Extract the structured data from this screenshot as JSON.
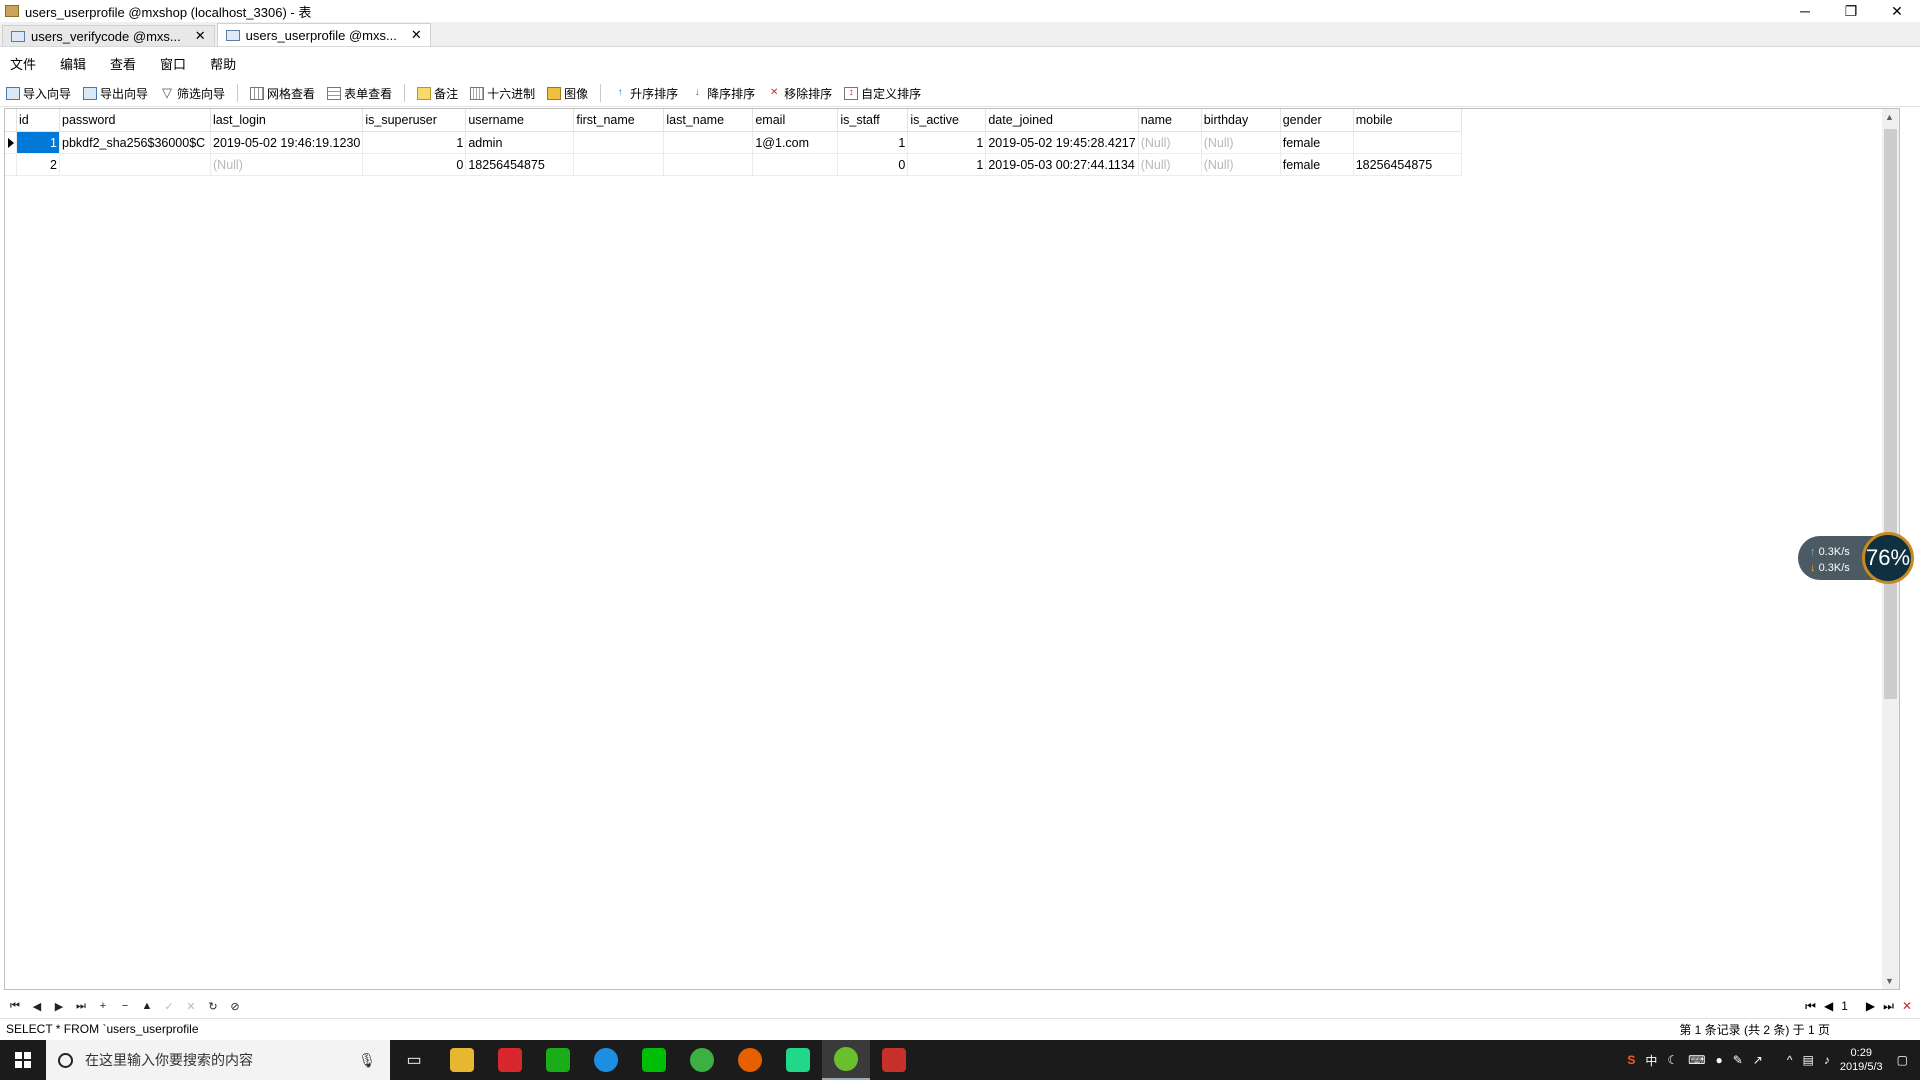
{
  "window": {
    "title": "users_userprofile @mxshop (localhost_3306) - 表",
    "minimize": "─",
    "restore": "❐",
    "close": "✕"
  },
  "tabs": [
    {
      "label": "users_verifycode @mxs...",
      "close": "✕"
    },
    {
      "label": "users_userprofile @mxs...",
      "close": "✕"
    }
  ],
  "menu": [
    "文件",
    "编辑",
    "查看",
    "窗口",
    "帮助"
  ],
  "toolbar": {
    "import": "导入向导",
    "export": "导出向导",
    "filter": "筛选向导",
    "grid_view": "网格查看",
    "form_view": "表单查看",
    "memo": "备注",
    "hex": "十六进制",
    "image": "图像",
    "sort_asc": "升序排序",
    "sort_desc": "降序排序",
    "remove_sort": "移除排序",
    "custom_sort": "自定义排序"
  },
  "grid": {
    "columns": [
      "id",
      "password",
      "last_login",
      "is_superuser",
      "username",
      "first_name",
      "last_name",
      "email",
      "is_staff",
      "is_active",
      "date_joined",
      "name",
      "birthday",
      "gender",
      "mobile"
    ],
    "rows": [
      [
        "1",
        "pbkdf2_sha256$36000$C",
        "2019-05-02 19:46:19.1230",
        "1",
        "admin",
        "",
        "",
        "1@1.com",
        "1",
        "1",
        "2019-05-02 19:45:28.4217",
        "(Null)",
        "(Null)",
        "female",
        ""
      ],
      [
        "2",
        "",
        "(Null)",
        "0",
        "18256454875",
        "",
        "",
        "",
        "0",
        "1",
        "2019-05-03 00:27:44.1134",
        "(Null)",
        "(Null)",
        "female",
        "18256454875"
      ]
    ]
  },
  "net_widget": {
    "up": "0.3K/s",
    "down": "0.3K/s",
    "percent": "76%"
  },
  "nav": {
    "page": "1"
  },
  "status": {
    "sql": "SELECT * FROM `users_userprofile",
    "records": "第 1 条记录 (共 2 条) 于 1 页"
  },
  "taskbar": {
    "search_placeholder": "在这里输入你要搜索的内容",
    "tray_text": "中",
    "time": "0:29",
    "date": "2019/5/3"
  }
}
